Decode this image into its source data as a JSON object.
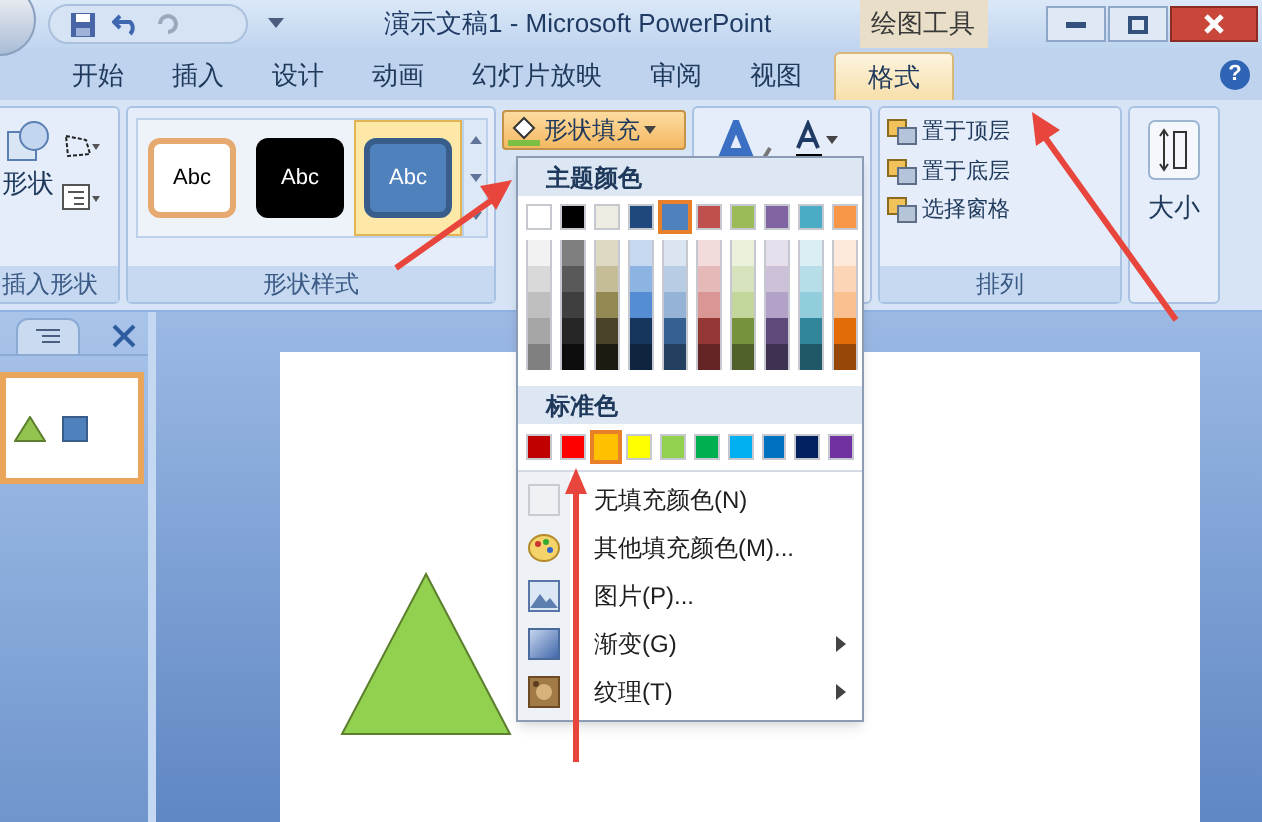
{
  "window": {
    "title": "演示文稿1 - Microsoft PowerPoint",
    "context_label": "绘图工具"
  },
  "tabs": [
    {
      "label": "开始",
      "selected": false
    },
    {
      "label": "插入",
      "selected": false
    },
    {
      "label": "设计",
      "selected": false
    },
    {
      "label": "动画",
      "selected": false
    },
    {
      "label": "幻灯片放映",
      "selected": false
    },
    {
      "label": "审阅",
      "selected": false
    },
    {
      "label": "视图",
      "selected": false
    },
    {
      "label": "格式",
      "selected": true
    }
  ],
  "help": "?",
  "ribbon": {
    "insert_shapes": {
      "button": "形状",
      "label": "插入形状"
    },
    "shape_styles": {
      "label": "形状样式",
      "styles": [
        {
          "text": "Abc",
          "kind": "outline",
          "selected": false
        },
        {
          "text": "Abc",
          "kind": "dark",
          "selected": false
        },
        {
          "text": "Abc",
          "kind": "blue",
          "selected": true
        }
      ]
    },
    "fill_button": {
      "label": "形状填充",
      "pressed": true
    },
    "arrange": {
      "label": "排列",
      "buttons": [
        "置于顶层",
        "置于底层",
        "选择窗格"
      ]
    },
    "size": {
      "label": "大小"
    }
  },
  "fill_menu": {
    "theme_header": "主题颜色",
    "theme_colors": [
      {
        "color": "#ffffff",
        "selected": false,
        "shades": [
          {
            "color": "#f2f2f2"
          },
          {
            "color": "#d9d9d9"
          },
          {
            "color": "#bfbfbf"
          },
          {
            "color": "#a6a6a6"
          },
          {
            "color": "#808080"
          }
        ]
      },
      {
        "color": "#000000",
        "selected": false,
        "shades": [
          {
            "color": "#7f7f7f"
          },
          {
            "color": "#595959"
          },
          {
            "color": "#3f3f3f"
          },
          {
            "color": "#262626"
          },
          {
            "color": "#0d0d0d"
          }
        ]
      },
      {
        "color": "#eeece1",
        "selected": false,
        "shades": [
          {
            "color": "#ddd9c3"
          },
          {
            "color": "#c4bd97"
          },
          {
            "color": "#938953"
          },
          {
            "color": "#494429"
          },
          {
            "color": "#1d1b10"
          }
        ]
      },
      {
        "color": "#1f497d",
        "selected": false,
        "shades": [
          {
            "color": "#c6d9f0"
          },
          {
            "color": "#8db3e2"
          },
          {
            "color": "#548dd4"
          },
          {
            "color": "#17365d"
          },
          {
            "color": "#0f243e"
          }
        ]
      },
      {
        "color": "#4f81bd",
        "selected": true,
        "shades": [
          {
            "color": "#dbe5f1"
          },
          {
            "color": "#b8cce4"
          },
          {
            "color": "#95b3d7"
          },
          {
            "color": "#366092"
          },
          {
            "color": "#244061"
          }
        ]
      },
      {
        "color": "#c0504d",
        "selected": false,
        "shades": [
          {
            "color": "#f2dcdb"
          },
          {
            "color": "#e5b9b7"
          },
          {
            "color": "#d99694"
          },
          {
            "color": "#953734"
          },
          {
            "color": "#632423"
          }
        ]
      },
      {
        "color": "#9bbb59",
        "selected": false,
        "shades": [
          {
            "color": "#ebf1dd"
          },
          {
            "color": "#d7e3bc"
          },
          {
            "color": "#c3d69b"
          },
          {
            "color": "#76923c"
          },
          {
            "color": "#4f6128"
          }
        ]
      },
      {
        "color": "#8064a2",
        "selected": false,
        "shades": [
          {
            "color": "#e5e0ec"
          },
          {
            "color": "#ccc1d9"
          },
          {
            "color": "#b2a2c7"
          },
          {
            "color": "#5f497a"
          },
          {
            "color": "#3f3151"
          }
        ]
      },
      {
        "color": "#4bacc6",
        "selected": false,
        "shades": [
          {
            "color": "#dbeef3"
          },
          {
            "color": "#b7dde8"
          },
          {
            "color": "#92cddc"
          },
          {
            "color": "#31859b"
          },
          {
            "color": "#205867"
          }
        ]
      },
      {
        "color": "#f79646",
        "selected": false,
        "shades": [
          {
            "color": "#fdeada"
          },
          {
            "color": "#fbd5b5"
          },
          {
            "color": "#fac08f"
          },
          {
            "color": "#e36c09"
          },
          {
            "color": "#974806"
          }
        ]
      }
    ],
    "standard_header": "标准色",
    "standard_colors": [
      {
        "color": "#c00000",
        "selected": false
      },
      {
        "color": "#ff0000",
        "selected": false
      },
      {
        "color": "#ffc000",
        "selected": true
      },
      {
        "color": "#ffff00",
        "selected": false
      },
      {
        "color": "#92d050",
        "selected": false
      },
      {
        "color": "#00b050",
        "selected": false
      },
      {
        "color": "#00b0f0",
        "selected": false
      },
      {
        "color": "#0070c0",
        "selected": false
      },
      {
        "color": "#002060",
        "selected": false
      },
      {
        "color": "#7030a0",
        "selected": false
      }
    ],
    "items": [
      {
        "label": "无填充颜色(N)",
        "kind": "none",
        "submenu": false
      },
      {
        "label": "其他填充颜色(M)...",
        "kind": "palette",
        "submenu": false
      },
      {
        "label": "图片(P)...",
        "kind": "picture",
        "submenu": false
      },
      {
        "label": "渐变(G)",
        "kind": "gradient",
        "submenu": true
      },
      {
        "label": "纹理(T)",
        "kind": "texture",
        "submenu": true
      }
    ]
  }
}
